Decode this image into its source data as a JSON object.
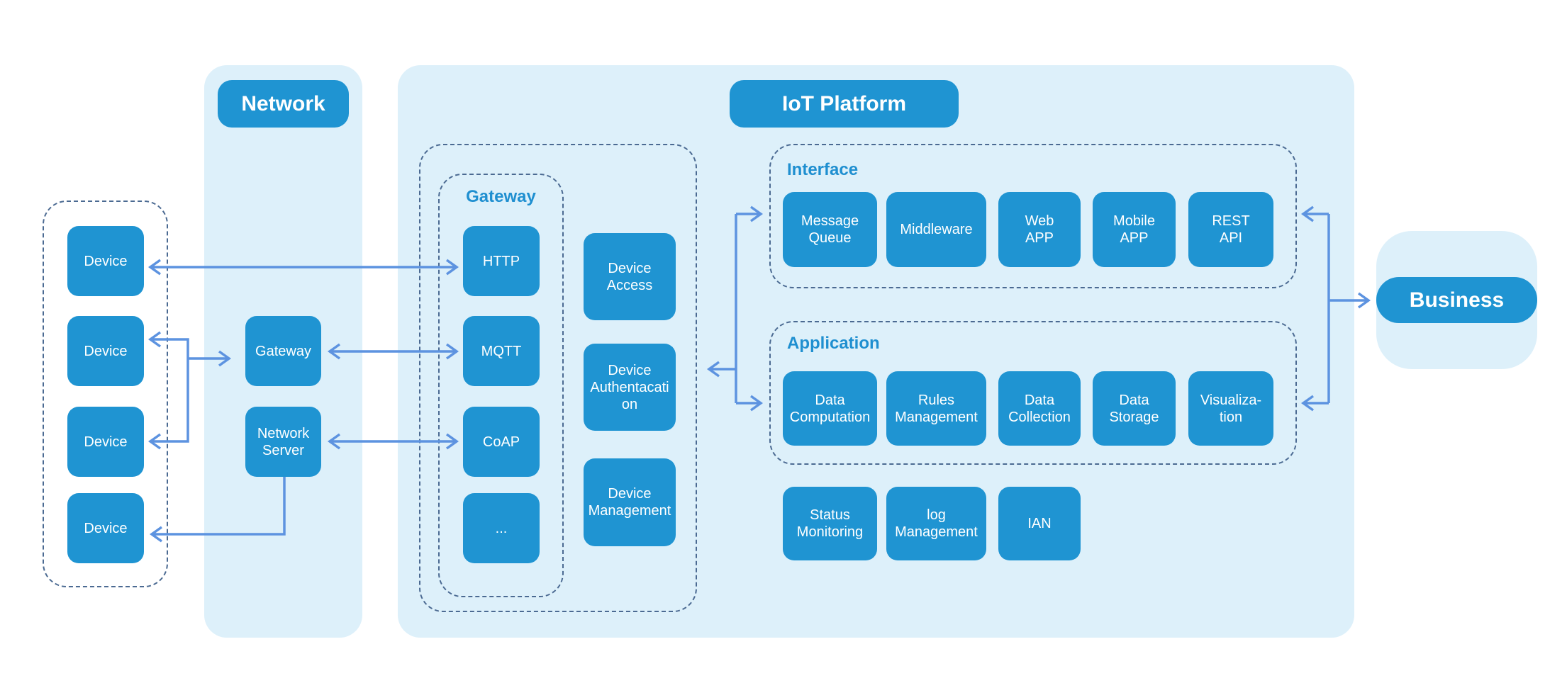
{
  "devices": [
    "Device",
    "Device",
    "Device",
    "Device"
  ],
  "network": {
    "title": "Network",
    "gateway": "Gateway",
    "network_server": "Network\nServer"
  },
  "platform": {
    "title": "IoT Platform",
    "gateway_label": "Gateway",
    "protocols": [
      "HTTP",
      "MQTT",
      "CoAP",
      "..."
    ],
    "device_services": [
      "Device\nAccess",
      "Device\nAuthentacati\non",
      "Device\nManagement"
    ],
    "interface": {
      "label": "Interface",
      "items": [
        "Message\nQueue",
        "Middleware",
        "Web\nAPP",
        "Mobile\nAPP",
        "REST\nAPI"
      ]
    },
    "application": {
      "label": "Application",
      "items": [
        "Data\nComputation",
        "Rules\nManagement",
        "Data\nCollection",
        "Data\nStorage",
        "Visualiza-\ntion"
      ]
    },
    "other": [
      "Status\nMonitoring",
      "log\nManagement",
      "IAN"
    ]
  },
  "business": {
    "title": "Business"
  },
  "colors": {
    "box": "#1f94d2",
    "panel": "#ddf0fa",
    "arrow": "#5d93e0",
    "dashed": "#4b6a92"
  }
}
